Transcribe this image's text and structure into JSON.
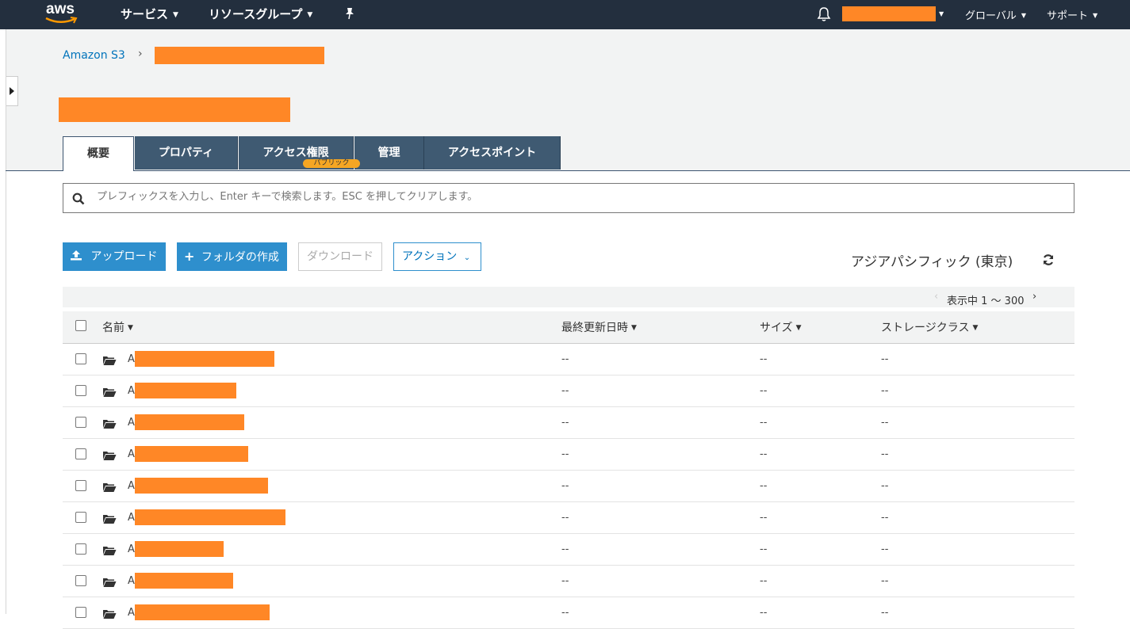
{
  "topnav": {
    "logo_text": "aws",
    "services_label": "サービス",
    "resource_groups_label": "リソースグループ",
    "region_label": "グローバル",
    "support_label": "サポート",
    "colors": {
      "background": "#232f3e",
      "redaction": "#ff8726"
    }
  },
  "breadcrumb": {
    "root": "Amazon S3"
  },
  "tabs": [
    {
      "label": "概要",
      "active": true
    },
    {
      "label": "プロパティ",
      "active": false
    },
    {
      "label": "アクセス権限",
      "active": false,
      "badge": "パブリック"
    },
    {
      "label": "管理",
      "active": false
    },
    {
      "label": "アクセスポイント",
      "active": false
    }
  ],
  "search": {
    "placeholder": "プレフィックスを入力し、Enter キーで検索します。ESC を押してクリアします。"
  },
  "toolbar": {
    "upload_label": "アップロード",
    "create_folder_label": "フォルダの作成",
    "download_label": "ダウンロード",
    "actions_label": "アクション",
    "region_text": "アジアパシフィック (東京)"
  },
  "pagination": {
    "text": "表示中 1 〜 300"
  },
  "table": {
    "columns": [
      "名前",
      "最終更新日時",
      "サイズ",
      "ストレージクラス"
    ],
    "rows": [
      {
        "name_prefix": "A",
        "last_modified": "--",
        "size": "--",
        "storage_class": "--"
      },
      {
        "name_prefix": "A",
        "last_modified": "--",
        "size": "--",
        "storage_class": "--"
      },
      {
        "name_prefix": "A",
        "last_modified": "--",
        "size": "--",
        "storage_class": "--"
      },
      {
        "name_prefix": "A",
        "last_modified": "--",
        "size": "--",
        "storage_class": "--"
      },
      {
        "name_prefix": "A",
        "last_modified": "--",
        "size": "--",
        "storage_class": "--"
      },
      {
        "name_prefix": "A",
        "last_modified": "--",
        "size": "--",
        "storage_class": "--"
      },
      {
        "name_prefix": "A",
        "last_modified": "--",
        "size": "--",
        "storage_class": "--"
      },
      {
        "name_prefix": "A",
        "last_modified": "--",
        "size": "--",
        "storage_class": "--"
      },
      {
        "name_prefix": "A",
        "last_modified": "--",
        "size": "--",
        "storage_class": "--"
      }
    ]
  },
  "icons": [
    "bell-icon",
    "pin-icon",
    "search-icon",
    "upload-icon",
    "plus-icon",
    "refresh-icon",
    "folder-icon",
    "chevron-down-icon",
    "sidebar-toggle-icon"
  ]
}
